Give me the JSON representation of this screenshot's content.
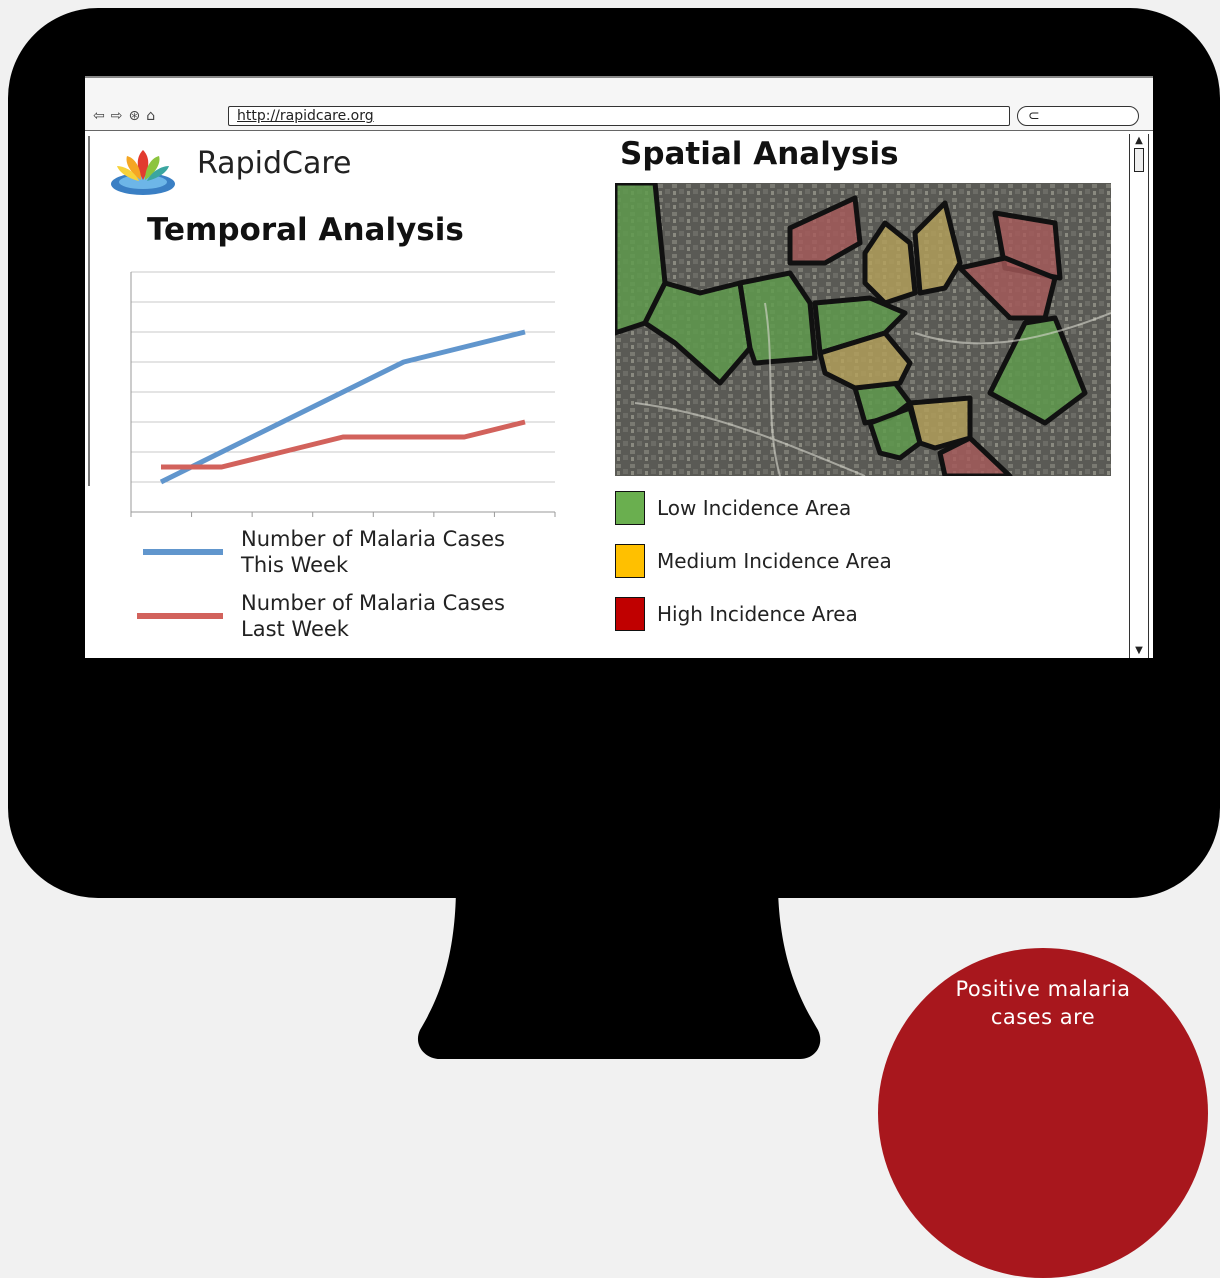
{
  "browser": {
    "url": "http://rapidcare.org"
  },
  "app": {
    "brand": "RapidCare"
  },
  "temporal": {
    "title": "Temporal Analysis",
    "legend": [
      {
        "line1": "Number of Malaria Cases",
        "line2": "This Week",
        "color": "#6196cd"
      },
      {
        "line1": "Number of Malaria Cases",
        "line2": "Last Week",
        "color": "#d2625c"
      }
    ]
  },
  "spatial": {
    "title": "Spatial Analysis",
    "legend": [
      {
        "label": "Low Incidence Area",
        "color": "#6aaf4f"
      },
      {
        "label": "Medium Incidence Area",
        "color": "#ffc000"
      },
      {
        "label": "High Incidence Area",
        "color": "#c00000"
      }
    ]
  },
  "callout": {
    "line1": "Positive malaria",
    "line2": "cases are"
  },
  "colors": {
    "background": "#f1f1f1",
    "monitor": "#000000",
    "callout": "#a8171d"
  },
  "chart_data": {
    "type": "line",
    "title": "Temporal Analysis",
    "xlabel": "",
    "ylabel": "",
    "x": [
      1,
      2,
      3,
      4,
      5,
      6,
      7
    ],
    "grid": true,
    "legend": "bottom",
    "series": [
      {
        "name": "Number of Malaria Cases This Week",
        "values": [
          1,
          2,
          3,
          4,
          5,
          5.5,
          6
        ]
      },
      {
        "name": "Number of Malaria Cases Last Week",
        "values": [
          1.5,
          1.5,
          2,
          2.5,
          2.5,
          2.5,
          3
        ]
      }
    ],
    "ylim": [
      0,
      8
    ]
  }
}
